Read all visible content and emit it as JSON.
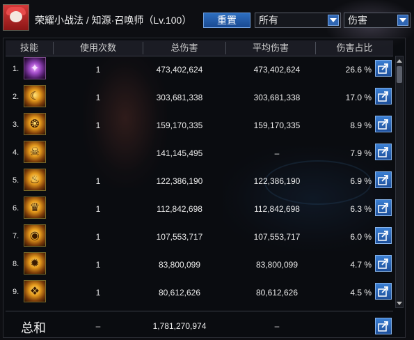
{
  "header": {
    "title": "荣耀小战法 / 知源·召唤师（Lv.100）",
    "reset_label": "重置",
    "filter_value": "所有",
    "sort_value": "伤害"
  },
  "columns": [
    "技能",
    "使用次数",
    "总伤害",
    "平均伤害",
    "伤害占比"
  ],
  "rows": [
    {
      "idx": "1.",
      "icon": "purple-flame-skill-icon",
      "count": "1",
      "total": "473,402,624",
      "avg": "473,402,624",
      "pct": "26.6 %"
    },
    {
      "idx": "2.",
      "icon": "golden-crescent-skill-icon",
      "count": "1",
      "total": "303,681,338",
      "avg": "303,681,338",
      "pct": "17.0 %"
    },
    {
      "idx": "3.",
      "icon": "golden-swirl-skill-icon",
      "count": "1",
      "total": "159,170,335",
      "avg": "159,170,335",
      "pct": "8.9 %"
    },
    {
      "idx": "4.",
      "icon": "golden-demon-mask-skill-icon",
      "count": "",
      "total": "141,145,495",
      "avg": "–",
      "pct": "7.9 %"
    },
    {
      "idx": "5.",
      "icon": "golden-flame-skill-icon",
      "count": "1",
      "total": "122,386,190",
      "avg": "122,386,190",
      "pct": "6.9 %"
    },
    {
      "idx": "6.",
      "icon": "golden-crown-skill-icon",
      "count": "1",
      "total": "112,842,698",
      "avg": "112,842,698",
      "pct": "6.3 %"
    },
    {
      "idx": "7.",
      "icon": "golden-orb-skill-icon",
      "count": "1",
      "total": "107,553,717",
      "avg": "107,553,717",
      "pct": "6.0 %"
    },
    {
      "idx": "8.",
      "icon": "golden-beast-skill-icon",
      "count": "1",
      "total": "83,800,099",
      "avg": "83,800,099",
      "pct": "4.7 %"
    },
    {
      "idx": "9.",
      "icon": "golden-dragon-skill-icon",
      "count": "1",
      "total": "80,612,626",
      "avg": "80,612,626",
      "pct": "4.5 %"
    }
  ],
  "total": {
    "label": "总和",
    "count": "–",
    "total": "1,781,270,974",
    "avg": "–"
  }
}
